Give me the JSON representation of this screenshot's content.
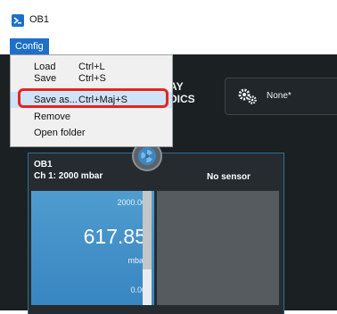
{
  "window": {
    "title": "OB1"
  },
  "menubar": {
    "config_label": "Config"
  },
  "config_menu": {
    "items": [
      {
        "label": "Load",
        "shortcut": "Ctrl+L"
      },
      {
        "label": "Save",
        "shortcut": "Ctrl+S"
      },
      {
        "label": "Save as...",
        "shortcut": "Ctrl+Maj+S"
      },
      {
        "label": "Remove",
        "shortcut": ""
      },
      {
        "label": "Open folder",
        "shortcut": ""
      }
    ]
  },
  "brand": {
    "line1": "AY",
    "line2": "DICS"
  },
  "configuration": {
    "value": "None*"
  },
  "instrument": {
    "name": "OB1",
    "channel_label": "Ch 1: 2000 mbar",
    "sensor_label": "No sensor",
    "gauge_max": "2000.00",
    "gauge_value": "617.85",
    "gauge_unit": "mbar",
    "gauge_min": "0.00",
    "level_fraction": 0.309
  },
  "colors": {
    "accent": "#1e6fc7",
    "app_background": "#1b2023",
    "gauge_blue": "#3886c2",
    "highlight_red": "#e42424"
  }
}
